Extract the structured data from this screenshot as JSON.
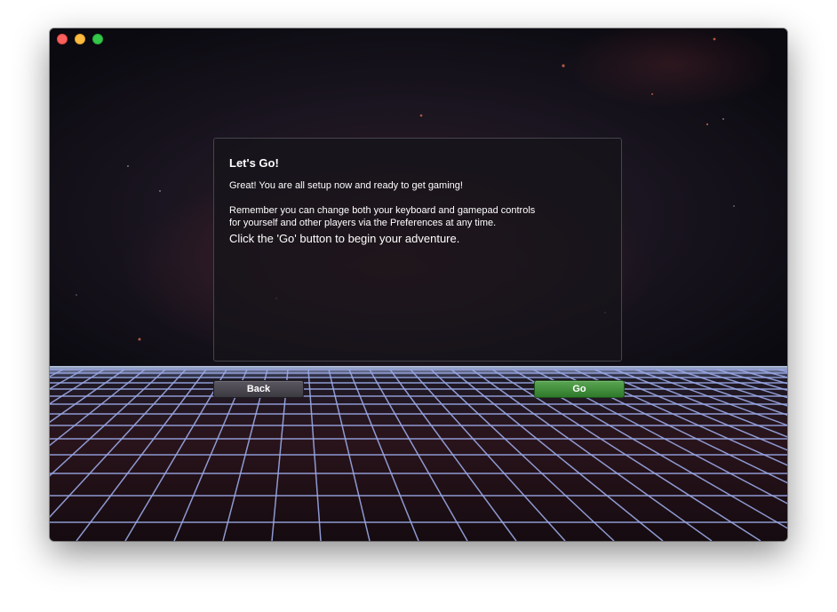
{
  "window": {
    "traffic_lights": [
      "close",
      "minimize",
      "zoom"
    ]
  },
  "panel": {
    "title": "Let's Go!",
    "line1": "Great! You are all setup now and ready to get gaming!",
    "line2": "Remember you can change both your keyboard and gamepad controls",
    "line3": "for yourself and other players via the Preferences at any time.",
    "cta": "Click the 'Go' button to begin your adventure."
  },
  "buttons": {
    "back_label": "Back",
    "go_label": "Go"
  },
  "colors": {
    "go_accent": "#3b8c35",
    "grid_line": "#9aa8e6",
    "close": "#fc605c",
    "minimize": "#fdbc40",
    "zoom": "#34c84a"
  }
}
